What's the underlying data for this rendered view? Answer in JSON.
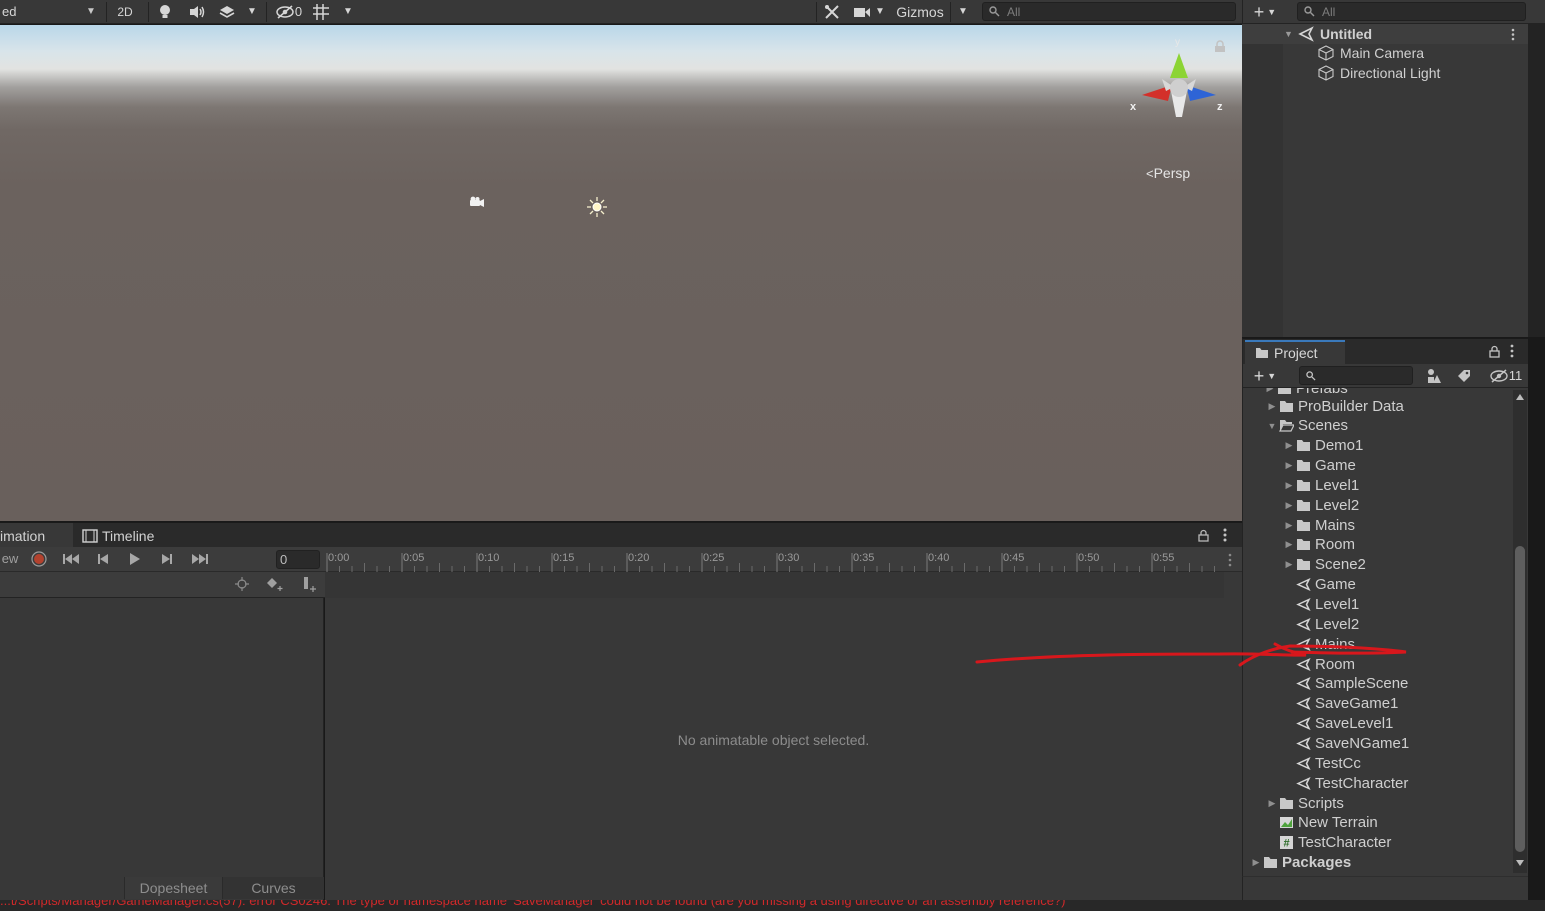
{
  "scene_toolbar": {
    "left_dropdown": "ed",
    "mode_2d": "2D",
    "hidden_count": "0",
    "gizmos_label": "Gizmos",
    "search_placeholder": "All"
  },
  "scene_view": {
    "projection_label": "Persp",
    "axis_x": "x",
    "axis_y": "y",
    "axis_z": "z"
  },
  "animation": {
    "tab_animation": "imation",
    "tab_timeline": "Timeline",
    "preview_label": "ew",
    "frame_value": "0",
    "time_labels": [
      "0:00",
      "0:05",
      "0:10",
      "0:15",
      "0:20",
      "0:25",
      "0:30",
      "0:35",
      "0:40",
      "0:45",
      "0:50",
      "0:55"
    ],
    "empty_message": "No animatable object selected.",
    "tab_dopesheet": "Dopesheet",
    "tab_curves": "Curves"
  },
  "hierarchy": {
    "search_placeholder": "All",
    "scene_name": "Untitled",
    "objects": [
      "Main Camera",
      "Directional Light"
    ]
  },
  "project": {
    "tab_label": "Project",
    "hidden_count": "11",
    "partial_top_item": "Prefabs",
    "items": [
      {
        "label": "ProBuilder Data",
        "type": "folder",
        "depth": 1,
        "expand": "collapsed"
      },
      {
        "label": "Scenes",
        "type": "folder-open",
        "depth": 1,
        "expand": "expanded"
      },
      {
        "label": "Demo1",
        "type": "folder",
        "depth": 2,
        "expand": "collapsed"
      },
      {
        "label": "Game",
        "type": "folder",
        "depth": 2,
        "expand": "collapsed"
      },
      {
        "label": "Level1",
        "type": "folder",
        "depth": 2,
        "expand": "collapsed"
      },
      {
        "label": "Level2",
        "type": "folder",
        "depth": 2,
        "expand": "collapsed"
      },
      {
        "label": "Mains",
        "type": "folder",
        "depth": 2,
        "expand": "collapsed"
      },
      {
        "label": "Room",
        "type": "folder",
        "depth": 2,
        "expand": "collapsed"
      },
      {
        "label": "Scene2",
        "type": "folder",
        "depth": 2,
        "expand": "collapsed"
      },
      {
        "label": "Game",
        "type": "scene",
        "depth": 2,
        "expand": "none"
      },
      {
        "label": "Level1",
        "type": "scene",
        "depth": 2,
        "expand": "none"
      },
      {
        "label": "Level2",
        "type": "scene",
        "depth": 2,
        "expand": "none"
      },
      {
        "label": "Mains",
        "type": "scene",
        "depth": 2,
        "expand": "none"
      },
      {
        "label": "Room",
        "type": "scene",
        "depth": 2,
        "expand": "none"
      },
      {
        "label": "SampleScene",
        "type": "scene",
        "depth": 2,
        "expand": "none"
      },
      {
        "label": "SaveGame1",
        "type": "scene",
        "depth": 2,
        "expand": "none"
      },
      {
        "label": "SaveLevel1",
        "type": "scene",
        "depth": 2,
        "expand": "none"
      },
      {
        "label": "SaveNGame1",
        "type": "scene",
        "depth": 2,
        "expand": "none"
      },
      {
        "label": "TestCc",
        "type": "scene",
        "depth": 2,
        "expand": "none"
      },
      {
        "label": "TestCharacter",
        "type": "scene",
        "depth": 2,
        "expand": "none"
      },
      {
        "label": "Scripts",
        "type": "folder",
        "depth": 1,
        "expand": "collapsed"
      },
      {
        "label": "New Terrain",
        "type": "terrain",
        "depth": 1,
        "expand": "none"
      },
      {
        "label": "TestCharacter",
        "type": "script",
        "depth": 1,
        "expand": "none"
      },
      {
        "label": "Packages",
        "type": "folder",
        "depth": 0,
        "expand": "collapsed"
      }
    ]
  },
  "console": {
    "error_text": "...t/Scripts/Manager/GameManager.cs(57): error CS0246: The type or namespace name 'SaveManager' could not be found (are you missing a using directive or an assembly reference?)"
  },
  "colors": {
    "annotation_red": "#d8171c",
    "accent_blue": "#3a79bb",
    "error_red": "#d0292a"
  }
}
